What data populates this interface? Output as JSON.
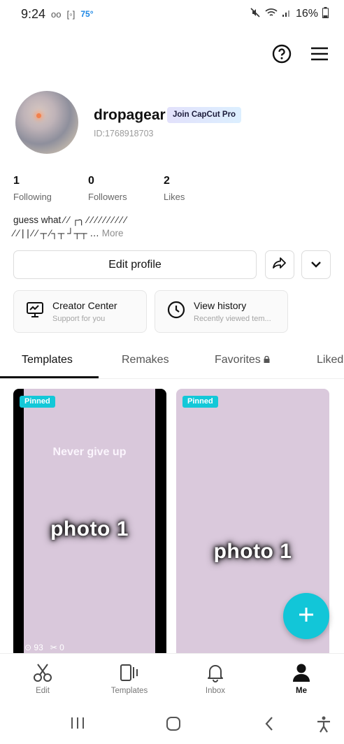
{
  "status_bar": {
    "time": "9:24",
    "voicemail": "oo",
    "temperature": "75°",
    "battery": "16%"
  },
  "profile": {
    "username": "dropagear",
    "pro_badge": "Join CapCut Pro",
    "user_id": "ID:1768918703"
  },
  "stats": [
    {
      "value": "1",
      "label": "Following"
    },
    {
      "value": "0",
      "label": "Followers"
    },
    {
      "value": "2",
      "label": "Likes"
    }
  ],
  "bio": {
    "line1": "guess what ⁄ ⁄  ┌╮ ⁄ ⁄ ⁄ ⁄ ⁄ ⁄ ⁄ ⁄ ⁄ ⁄",
    "line2": "⁄ ⁄ | | ⁄ ⁄ ┬ ⁄┐┬ ┘┬┬ …",
    "more": "More"
  },
  "actions": {
    "edit_profile": "Edit profile"
  },
  "cards": [
    {
      "title": "Creator Center",
      "subtitle": "Support for you"
    },
    {
      "title": "View history",
      "subtitle": "Recently viewed tem..."
    }
  ],
  "tabs": [
    {
      "label": "Templates"
    },
    {
      "label": "Remakes"
    },
    {
      "label": "Favorites"
    },
    {
      "label": "Liked"
    }
  ],
  "tiles": [
    {
      "badge": "Pinned",
      "caption": "Never give up",
      "photo_text": "photo 1",
      "views": "93",
      "uses": "0"
    },
    {
      "badge": "Pinned",
      "photo_text": "photo 1"
    }
  ],
  "bottom_nav": [
    {
      "label": "Edit",
      "icon": "scissors-icon"
    },
    {
      "label": "Templates",
      "icon": "templates-icon"
    },
    {
      "label": "Inbox",
      "icon": "bell-icon"
    },
    {
      "label": "Me",
      "icon": "person-icon"
    }
  ],
  "colors": {
    "accent": "#12c6d8",
    "tile_bg": "#dac9dc"
  }
}
